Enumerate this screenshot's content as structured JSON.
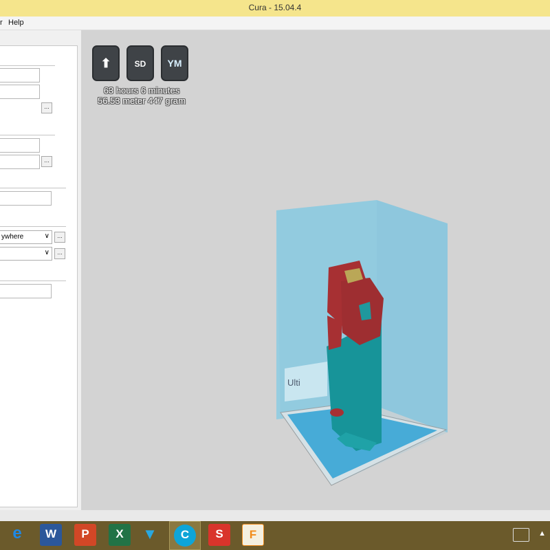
{
  "window": {
    "title": "Cura - 15.04.4"
  },
  "menu": {
    "partial_item": "r",
    "help_label": "Help"
  },
  "left_panel": {
    "fields": [
      {
        "value": ""
      },
      {
        "value": ""
      },
      {
        "value": ""
      },
      {
        "value": ""
      },
      {
        "value": ""
      },
      {
        "value": ""
      }
    ],
    "dots_label": "...",
    "support_select": {
      "selected": "ywhere"
    },
    "adhesion_select": {
      "selected": ""
    },
    "select_arrow": "∨"
  },
  "viewport": {
    "tools": [
      {
        "name": "load-icon",
        "glyph": "⬆"
      },
      {
        "name": "sd-card-icon",
        "glyph": "SD"
      },
      {
        "name": "youmagine-icon",
        "glyph": "YM"
      }
    ],
    "print_time": "63 hours 6 minutes",
    "print_material": "56.53 meter 447 gram",
    "build_plate_label": "Ulti",
    "colors": {
      "background": "#d3d3d3",
      "volume": "#7fc4e0",
      "model_red": "#b0100e",
      "model_teal": "#008a8a"
    }
  },
  "taskbar": {
    "apps": [
      {
        "name": "internet-explorer-icon",
        "glyph": "e",
        "color": "#1e88e5"
      },
      {
        "name": "word-icon",
        "glyph": "W",
        "color": "#2b579a"
      },
      {
        "name": "powerpoint-icon",
        "glyph": "P",
        "color": "#d24726"
      },
      {
        "name": "excel-icon",
        "glyph": "X",
        "color": "#217346"
      },
      {
        "name": "filter-app-icon",
        "glyph": "▼",
        "color": "#29a8e0"
      },
      {
        "name": "cura-icon",
        "glyph": "C",
        "color": "#0ea5d8"
      },
      {
        "name": "sketchup-icon",
        "glyph": "S",
        "color": "#d9342b"
      },
      {
        "name": "file-app-icon",
        "glyph": "F",
        "color": "#f28c1a"
      }
    ],
    "tray_arrow": "▲"
  }
}
